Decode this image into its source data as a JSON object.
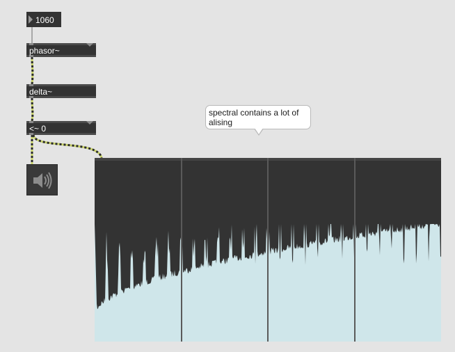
{
  "patcher": {
    "number_box": {
      "value": "1060"
    },
    "objects": [
      {
        "id": "phasor",
        "label": "phasor~"
      },
      {
        "id": "delta",
        "label": "delta~"
      },
      {
        "id": "less_than",
        "label": "<~ 0"
      }
    ],
    "comment": {
      "text": "spectral contains a lot of alising"
    },
    "dac": {
      "icon": "speaker-icon"
    }
  },
  "colors": {
    "canvas_bg": "#e4e4e4",
    "object_bg": "#333333",
    "scope_bg": "#333333",
    "spectrum_fill": "#cfe6ea",
    "signal_cord": "#c9d36a",
    "signal_cord_dash": "#2b2b2b",
    "control_cord": "#a8a8a8"
  },
  "spectroscope": {
    "divisions": 4,
    "peak_count": 28
  }
}
